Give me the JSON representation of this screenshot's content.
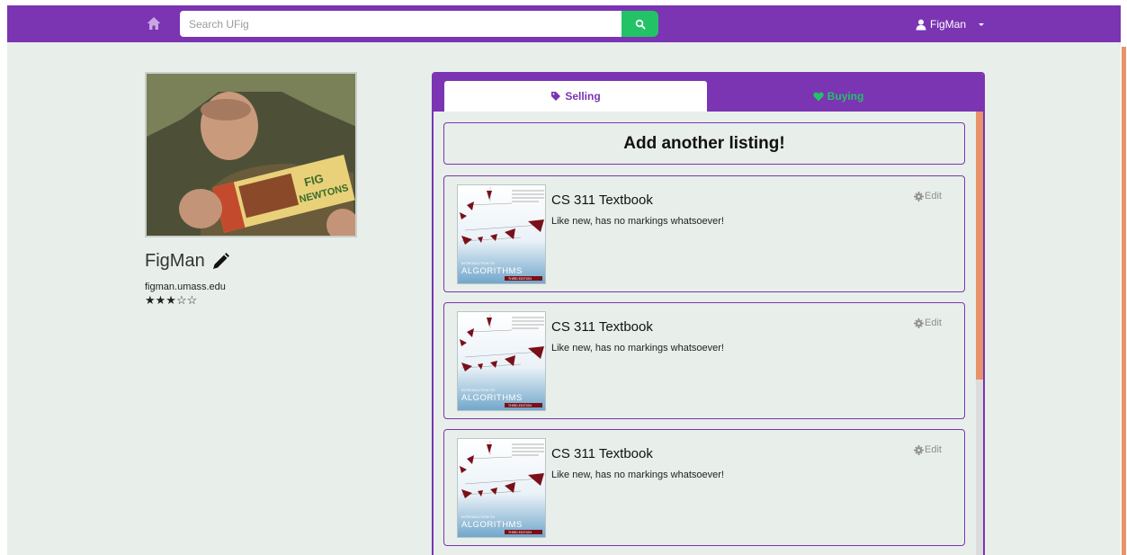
{
  "navbar": {
    "home_icon": "home-icon",
    "search_placeholder": "Search UFig",
    "search_icon": "search-icon",
    "username": "FigMan",
    "brand_color": "#7b34b2",
    "accent_color": "#22c266"
  },
  "profile": {
    "name": "FigMan",
    "email": "figman.umass.edu",
    "rating_stars": "★★★☆☆",
    "rating": 3,
    "rating_max": 5
  },
  "tabs": [
    {
      "label": "Selling",
      "icon": "tag-icon",
      "active": true
    },
    {
      "label": "Buying",
      "icon": "heart-icon",
      "active": false
    }
  ],
  "add_listing_label": "Add another listing!",
  "listings": [
    {
      "title": "CS 311 Textbook",
      "description": "Like new, has no markings whatsoever!",
      "edit_label": "Edit",
      "cover": {
        "series": "INTRODUCTION TO",
        "title": "ALGORITHMS",
        "edition": "THIRD EDITION"
      }
    },
    {
      "title": "CS 311 Textbook",
      "description": "Like new, has no markings whatsoever!",
      "edit_label": "Edit",
      "cover": {
        "series": "INTRODUCTION TO",
        "title": "ALGORITHMS",
        "edition": "THIRD EDITION"
      }
    },
    {
      "title": "CS 311 Textbook",
      "description": "Like new, has no markings whatsoever!",
      "edit_label": "Edit",
      "cover": {
        "series": "INTRODUCTION TO",
        "title": "ALGORITHMS",
        "edition": "THIRD EDITION"
      }
    }
  ]
}
